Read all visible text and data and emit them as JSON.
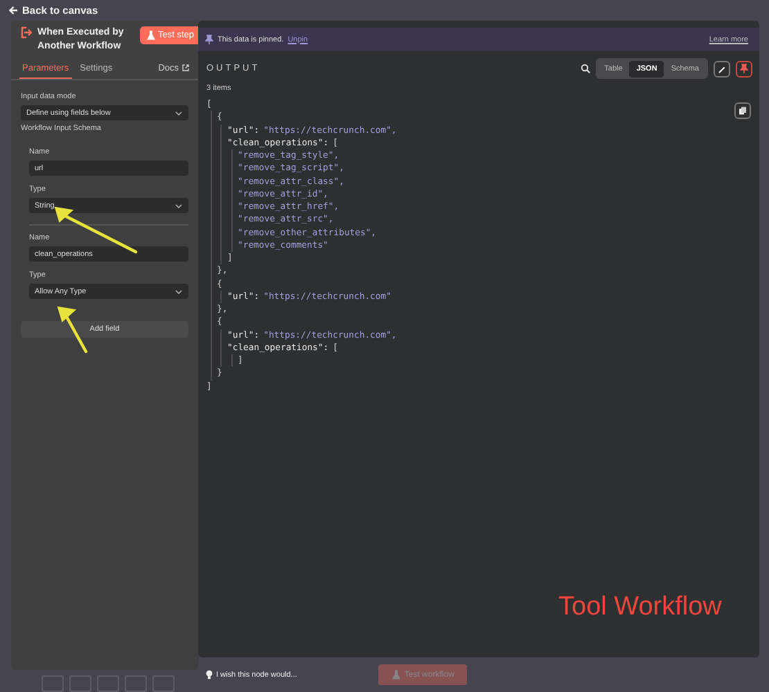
{
  "top_bar": {
    "back_link": "Back to canvas"
  },
  "node_panel": {
    "title": "When Executed by Another Workflow",
    "test_button": "Test step",
    "tabs": [
      {
        "label": "Parameters",
        "selected": true
      },
      {
        "label": "Settings",
        "selected": false
      }
    ],
    "docs_link": "Docs",
    "input_mode": {
      "label": "Input data mode",
      "value": "Define using fields below"
    },
    "schema_label": "Workflow Input Schema",
    "fields": [
      {
        "name_label": "Name",
        "name_value": "url",
        "type_label": "Type",
        "type_value": "String"
      },
      {
        "name_label": "Name",
        "name_value": "clean_operations",
        "type_label": "Type",
        "type_value": "Allow Any Type"
      }
    ],
    "add_button": "Add field"
  },
  "output_panel": {
    "banner": {
      "text": "This data is pinned.",
      "unpin": "Unpin",
      "learn_more": "Learn more"
    },
    "title": "OUTPUT",
    "views": [
      {
        "label": "Table",
        "selected": false
      },
      {
        "label": "JSON",
        "selected": true
      },
      {
        "label": "Schema",
        "selected": false
      }
    ],
    "pinned": true,
    "count": "3 items",
    "code": [
      {
        "open": "[",
        "close": "]",
        "children": [
          {
            "open": "{",
            "close": "},",
            "children": [
              {
                "key": "\"url\":",
                "value": "\"https://techcrunch.com\"",
                "punct": ","
              },
              {
                "key": "\"clean_operations\":",
                "open": "[",
                "close": "]",
                "children": [
                  {
                    "value": "\"remove_tag_style\"",
                    "punct": ","
                  },
                  {
                    "value": "\"remove_tag_script\"",
                    "punct": ","
                  },
                  {
                    "value": "\"remove_attr_class\"",
                    "punct": ","
                  },
                  {
                    "value": "\"remove_attr_id\"",
                    "punct": ","
                  },
                  {
                    "value": "\"remove_attr_href\"",
                    "punct": ","
                  },
                  {
                    "value": "\"remove_attr_src\"",
                    "punct": ","
                  },
                  {
                    "value": "\"remove_other_attributes\"",
                    "punct": ","
                  },
                  {
                    "value": "\"remove_comments\""
                  }
                ]
              }
            ]
          },
          {
            "open": "{",
            "close": "},",
            "children": [
              {
                "key": "\"url\":",
                "value": "\"https://techcrunch.com\""
              }
            ]
          },
          {
            "open": "{",
            "close": "}",
            "children": [
              {
                "key": "\"url\":",
                "value": "\"https://techcrunch.com\"",
                "punct": ","
              },
              {
                "key": "\"clean_operations\":",
                "open": "[",
                "close": "]"
              }
            ]
          }
        ]
      }
    ],
    "overlay_label": "Tool Workflow"
  },
  "bottom_bar": {
    "feedback": "I wish this node would...",
    "test_workflow": {
      "label": "Test workflow",
      "disabled": true
    }
  },
  "annotations": [
    {
      "kind": "arrow"
    },
    {
      "kind": "arrow"
    }
  ]
}
